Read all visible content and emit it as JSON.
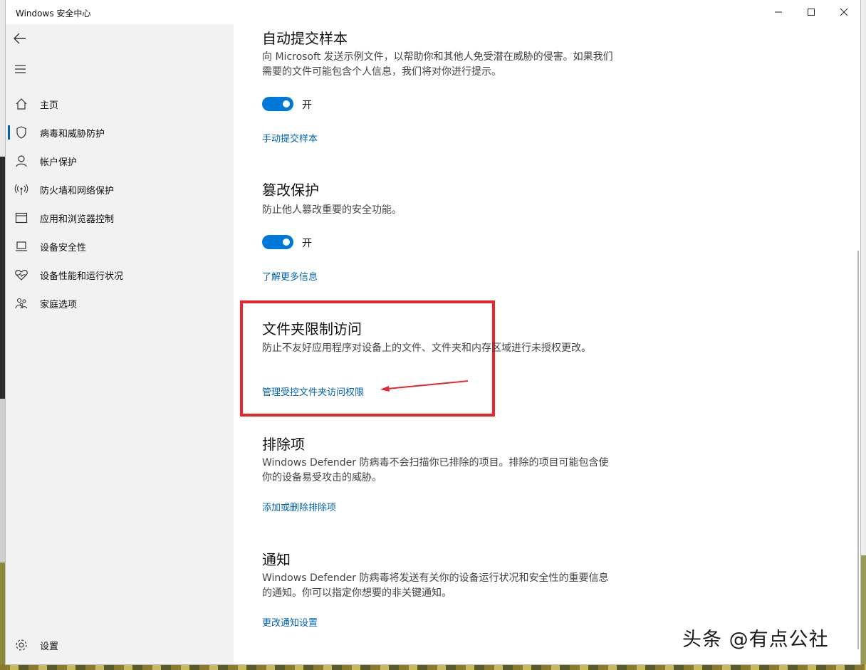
{
  "window": {
    "title": "Windows 安全中心",
    "controls": {
      "minimize_icon": "minimize-icon",
      "maximize_icon": "maximize-icon",
      "close_icon": "close-icon"
    }
  },
  "sidebar": {
    "back_icon": "back-arrow-icon",
    "menu_icon": "hamburger-icon",
    "items": [
      {
        "label": "主页",
        "icon": "home-icon"
      },
      {
        "label": "病毒和威胁防护",
        "icon": "shield-icon",
        "active": true
      },
      {
        "label": "帐户保护",
        "icon": "person-icon"
      },
      {
        "label": "防火墙和网络保护",
        "icon": "antenna-icon"
      },
      {
        "label": "应用和浏览器控制",
        "icon": "browser-window-icon"
      },
      {
        "label": "设备安全性",
        "icon": "laptop-icon"
      },
      {
        "label": "设备性能和运行状况",
        "icon": "heart-pulse-icon"
      },
      {
        "label": "家庭选项",
        "icon": "family-icon"
      }
    ],
    "settings": {
      "label": "设置",
      "icon": "gear-icon"
    }
  },
  "sections": {
    "auto_sample": {
      "title": "自动提交样本",
      "desc": "向 Microsoft 发送示例文件，以帮助你和其他人免受潜在威胁的侵害。如果我们需要的文件可能包含个人信息，我们将对你进行提示。",
      "toggle_label": "开",
      "toggle_on": true,
      "link": "手动提交样本"
    },
    "tamper": {
      "title": "篡改保护",
      "desc": "防止他人篡改重要的安全功能。",
      "toggle_label": "开",
      "toggle_on": true,
      "link": "了解更多信息"
    },
    "folder_access": {
      "title": "文件夹限制访问",
      "desc": "防止不友好应用程序对设备上的文件、文件夹和内存区域进行未授权更改。",
      "link": "管理受控文件夹访问权限"
    },
    "exclusions": {
      "title": "排除项",
      "desc": "Windows Defender 防病毒不会扫描你已排除的项目。排除的项目可能包含使你的设备易受攻击的威胁。",
      "link": "添加或删除排除项"
    },
    "notifications": {
      "title": "通知",
      "desc": "Windows Defender 防病毒将发送有关你的设备运行状况和安全性的重要信息的通知。你可以指定你想要的非关键通知。",
      "link": "更改通知设置"
    }
  },
  "annotation": {
    "box_color": "#e8262b",
    "arrow_color": "#e8262b"
  },
  "watermark": "头条 @有点公社",
  "colors": {
    "accent": "#0078d7",
    "link": "#0063b1",
    "sidebar_bg": "#f2f2f2"
  }
}
